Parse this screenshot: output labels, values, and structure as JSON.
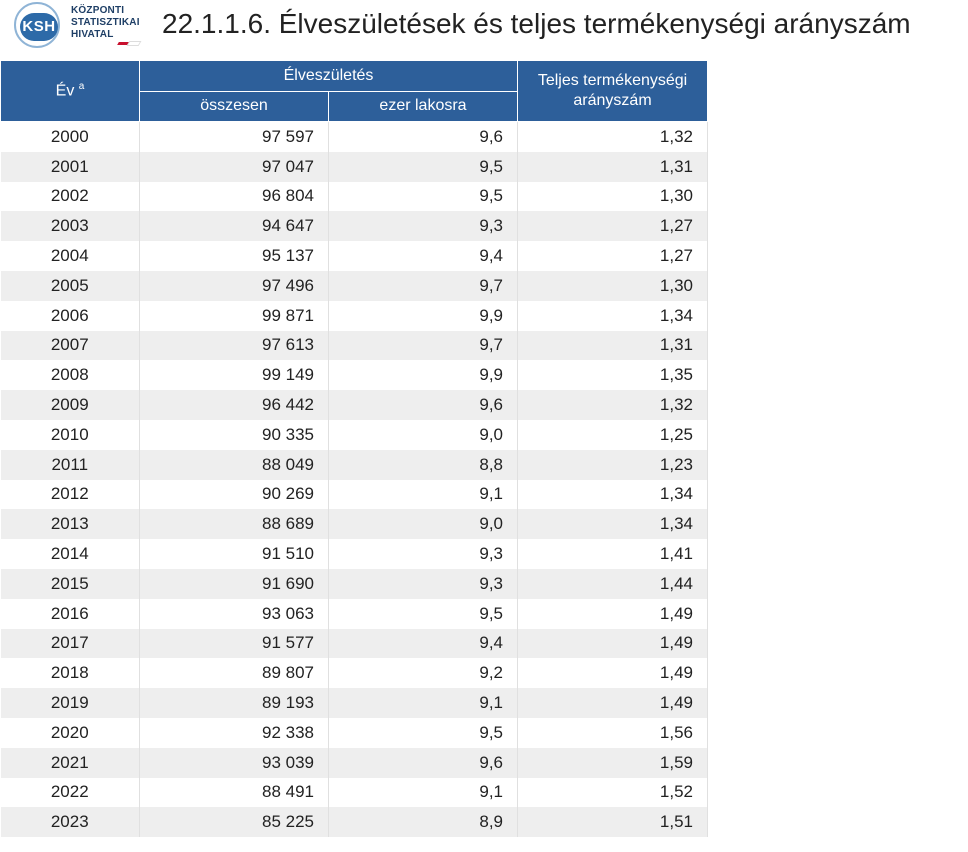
{
  "logo": {
    "badge": "KSH",
    "line1": "KÖZPONTI",
    "line2": "STATISZTIKAI",
    "line3": "HIVATAL",
    "flag_colors": [
      "#c8102e",
      "#ffffff",
      "#2e8b3a"
    ]
  },
  "title": "22.1.1.6. Élveszületések és teljes termékenységi arányszám",
  "table": {
    "col_year": "Év",
    "col_year_sup": "a",
    "group_live_births": "Élveszületés",
    "sub_total": "összesen",
    "sub_per_thousand": "ezer lakosra",
    "col_tfr_line1": "Teljes termékenységi",
    "col_tfr_line2": "arányszám",
    "rows": [
      [
        "2000",
        "97 597",
        "9,6",
        "1,32"
      ],
      [
        "2001",
        "97 047",
        "9,5",
        "1,31"
      ],
      [
        "2002",
        "96 804",
        "9,5",
        "1,30"
      ],
      [
        "2003",
        "94 647",
        "9,3",
        "1,27"
      ],
      [
        "2004",
        "95 137",
        "9,4",
        "1,27"
      ],
      [
        "2005",
        "97 496",
        "9,7",
        "1,30"
      ],
      [
        "2006",
        "99 871",
        "9,9",
        "1,34"
      ],
      [
        "2007",
        "97 613",
        "9,7",
        "1,31"
      ],
      [
        "2008",
        "99 149",
        "9,9",
        "1,35"
      ],
      [
        "2009",
        "96 442",
        "9,6",
        "1,32"
      ],
      [
        "2010",
        "90 335",
        "9,0",
        "1,25"
      ],
      [
        "2011",
        "88 049",
        "8,8",
        "1,23"
      ],
      [
        "2012",
        "90 269",
        "9,1",
        "1,34"
      ],
      [
        "2013",
        "88 689",
        "9,0",
        "1,34"
      ],
      [
        "2014",
        "91 510",
        "9,3",
        "1,41"
      ],
      [
        "2015",
        "91 690",
        "9,3",
        "1,44"
      ],
      [
        "2016",
        "93 063",
        "9,5",
        "1,49"
      ],
      [
        "2017",
        "91 577",
        "9,4",
        "1,49"
      ],
      [
        "2018",
        "89 807",
        "9,2",
        "1,49"
      ],
      [
        "2019",
        "89 193",
        "9,1",
        "1,49"
      ],
      [
        "2020",
        "92 338",
        "9,5",
        "1,56"
      ],
      [
        "2021",
        "93 039",
        "9,6",
        "1,59"
      ],
      [
        "2022",
        "88 491",
        "9,1",
        "1,52"
      ],
      [
        "2023",
        "85 225",
        "8,9",
        "1,51"
      ]
    ]
  }
}
